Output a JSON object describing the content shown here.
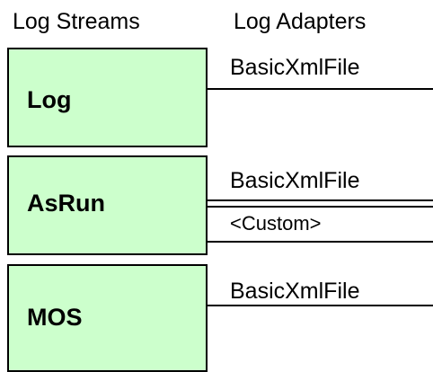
{
  "headers": {
    "streams": "Log Streams",
    "adapters": "Log Adapters"
  },
  "streams": [
    {
      "label": "Log",
      "adapters": [
        "BasicXmlFile"
      ]
    },
    {
      "label": "AsRun",
      "adapters": [
        "BasicXmlFile",
        "<Custom>"
      ]
    },
    {
      "label": "MOS",
      "adapters": [
        "BasicXmlFile"
      ]
    }
  ],
  "colors": {
    "stream_fill": "#ccffcc",
    "stroke": "#000000"
  }
}
